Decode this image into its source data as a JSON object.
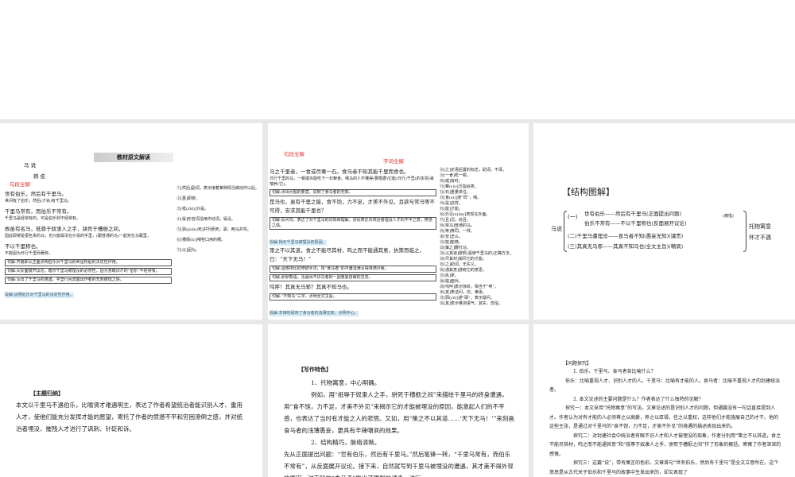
{
  "slide1": {
    "banner": "教材原文解读",
    "title": "马 说",
    "author": "韩 愈",
    "section": "句段全解",
    "lines": [
      "世有伯乐，然后有千里马。",
      "世间有了伯乐，然后(才会)有千里马。",
      "千里马常有，而伯乐不常有。",
      "千里马是经常有的，可是伯乐却不经常有。",
      "故虽有名马，祗辱于奴隶人之手，骈死于槽枥之间，",
      "因此即使是很名贵的马，也只能辱没在仆役的手里，(跟普通的马)一起死在马厩里，",
      "不以千里称也。",
      "不能因为日行千里而著称。"
    ],
    "notes_box": [
      "句解:开篇即从正面点明伯乐对千里马的命运所起的决定性作用。",
      "句解:从反面展开议论，暗示千里马被埋没的必然性，因为慧眼识才的“伯乐”不经常有。",
      "句解:写出了千里马的遭遇，字里行间流露出作者的无限痛惜之情。"
    ],
    "para_summary": "段解:说明伯乐对千里马的决定性作用。",
    "glossary": [
      "①[然后]副词，表示接着某种情况或动作以后。",
      "②[虽]即使。",
      "③[祗(zhǐ)]只是。",
      "④[辱]形容词活用作动词，辱没。",
      "⑤[骈(pián)死]并列而死。骈，两马并驾。",
      "⑥[槽枥(lì)]喂牲口用的槽。",
      "⑦[以]因为。"
    ]
  },
  "slide2": {
    "section_left": "句段全解",
    "section_right": "字词全解",
    "lines": [
      "马之千里者，一食或尽粟一石。食马者不知其能千里而食也。",
      "日行千里的马，一顿或许能吃下一石粮食。喂马的人不懂得(要根据)它能(日行)千里(的本领)来喂养(它)。",
      "句解:点出问题的要害，说到了食马者的无知。",
      "是马也，虽有千里之能，食不饱，力不足，才美不外见，且欲与常马等不可得，安求其能千里也？",
      "句解:反问句，表达了对千里马的同情和理解，进而表达对统治者埋没人才的不平之意，愤懑之情。",
      "段解:揭示千里马被埋没的原因。",
      "策之不以其道，食之不能尽其材，鸣之而不能通其意，执策而临之，曰：“天下无马！”",
      "句解:运用排比的修辞手法，将“食马者”的平庸浅薄写得淋漓尽致。",
      "句解:寥寥数语，活画出不识马者的一副愚妄自傲的丑态。",
      "呜呼！其真无马邪？其真不知马也。",
      "句解:“不知马”三字，点明全文主旨。",
      "段解:辛辣地讽刺了食马者的浅薄无知，点明中心。"
    ],
    "glossary": [
      "⑧[之]定语后置的标志，助词，不译。",
      "⑨[一食]吃一顿。",
      "⑩[或]有时。",
      "⑪[粟(sù)]泛指谷类。",
      "⑫[石]重量单位。",
      "⑬[食(sì)]通“饲”，喂。",
      "⑭[是]这样。",
      "⑮[能]才能。",
      "⑯[外见(xiàn)]表现在外面。",
      "⑰[且]况，尚且。",
      "⑱[常马]普通的马。",
      "⑲[等]等同，一样。",
      "⑳[安]怎么。",
      "㉑[能]能够。",
      "㉒[策之]鞭打马。",
      "㉓[以其道]按照(驱使千里马的)正确方法。",
      "㉔[尽其材]竭尽它的才能。",
      "㉕[之]助词，无实义。",
      "㉖[通其意]通晓它的意思。",
      "㉗[执]拿。",
      "㉘[临]面对。",
      "㉙[呜呼]表示惊叹，相当于“唉”。",
      "㉚[其]表诘问，岂，难道。",
      "㉛[邪(yé)]通“耶”，表示疑问。",
      "㉜[其]表示推测语气，其实，恐怕。"
    ]
  },
  "slide3": {
    "heading": "【结构图解】",
    "root": "马说",
    "part1": "(一)",
    "p1a": "世有伯乐——然后有千里马(正面提出问题)",
    "p1b": "伯乐不常有——不以千里称也(反面展开议论)",
    "p1note": "(痛惜)",
    "p2": "(二)千里马遭埋没——食马者不知(愚妄无知)(谴责)",
    "p3": "(三)其真无马邪——其真不知马也(全文主旨)(嘲讽)",
    "r1": "托物寓意",
    "r2": "怀才不遇"
  },
  "slide4": {
    "heading": "【主题归纳】",
    "body": "本文以千里马不遇伯乐，比喻贤才难遇明主，表达了作者希望统治者能识别人才、重用人才，使他们能充分发挥才能的愿望，寄托了作者的愤懑不平和穷困潦倒之感，并对统治者埋没、摧残人才进行了讽刺、针砭和诉。"
  },
  "slide5": {
    "heading": "【写作特色】",
    "p1": "1、托物寓意，中心明确。",
    "p2": "例如，用“祇辱于奴隶人之手，骈死于槽枥之间”来描绘千里马的终身遭遇，用“食不饱，力不足，才美不外见”来揭示它的才能被埋没的原因，能激起人们的不平感，也表达了当时有才能之人的悲愤。又如，用“策之不以其道……‘天下无马！’”来刻画食马者的浅薄愚妄，更具有辛辣嘲讽的效果。",
    "p3": "2、结构精巧，脉络清晰。",
    "p4": "先从正面提出问题：“世有伯乐，然后有千里马。”然后笔锋一转，“千里马常有，而伯乐不常有”，从反面展开议论。接下来，自然就写到千里马被埋没的遭遇，其才美不得外现的原因，对无知的“食马者”发出了强烈的谴责，进行"
  },
  "slide6": {
    "heading": "【问题探究】",
    "q1": "1. 伯乐、千里马、食马者各比喻什么？",
    "a1": "伯乐：比喻重视人才、识别人才的人。千里马：比喻有才能的人。食马者：比喻不重视人才的封建统治者。",
    "q2": "2. 本文论述的主要问题是什么？作者表达了什么独特的见解？",
    "a2": "探究一：本文采用“托物寓意”的写法。文章论述的是识别人才的问题，但通篇没有一句话直接提到人才。作者认为对有才能的人必须尊之以高爵，养之以厚禄，任之以重权，这样他们才能施展自己的才干。他的这些主张，是通过对千里马的“食不饱，力不足，才美不外见”的境遇的描述表现出来的。",
    "a3": "探究二：对封建社会中统治者有眼不识人才和人才被埋没的现象，作者分别用“策之不以其道，食之不能尽其材，鸣之而不能通其意”和“祇辱于奴隶人之手，骈死于槽枥之间”作了形象的概括，寄寓了作者深深的感慨。",
    "a4": "探究三：这篇“说”，带有寓言的色彩。文章首句“世有伯乐，然后有千里马”是全文立意所在。这个意思是从古代关于伯乐和千里马的故事中生发出来的，却又表现了"
  }
}
